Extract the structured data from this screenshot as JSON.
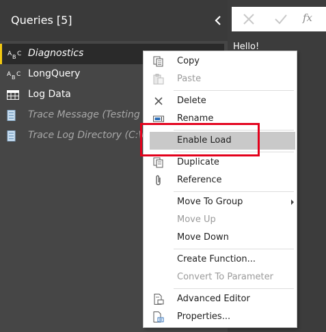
{
  "pane": {
    "title": "Queries [5]",
    "queries": [
      {
        "label": "Diagnostics",
        "icon": "text-type-icon",
        "selected": true
      },
      {
        "label": "LongQuery",
        "icon": "text-type-icon"
      },
      {
        "label": "Log Data",
        "icon": "table-icon"
      },
      {
        "label": "Trace Message (Testing Lon",
        "icon": "list-icon"
      },
      {
        "label": "Trace Log Directory (C:\\Us",
        "icon": "list-icon"
      }
    ]
  },
  "preview": {
    "text": "Hello!"
  },
  "formula_bar": {
    "fx_label": "fx"
  },
  "menu": {
    "items": [
      {
        "label": "Copy",
        "icon": "copy-icon",
        "enabled": true
      },
      {
        "label": "Paste",
        "icon": "paste-icon",
        "enabled": false
      },
      {
        "label": "Delete",
        "icon": "delete-icon",
        "enabled": true
      },
      {
        "label": "Rename",
        "icon": "rename-icon",
        "enabled": true
      },
      {
        "label": "Enable Load",
        "enabled": true,
        "highlighted": true
      },
      {
        "label": "Duplicate",
        "icon": "duplicate-icon",
        "enabled": true
      },
      {
        "label": "Reference",
        "icon": "paperclip-icon",
        "enabled": true
      },
      {
        "label": "Move To Group",
        "enabled": true,
        "submenu": true
      },
      {
        "label": "Move Up",
        "enabled": false
      },
      {
        "label": "Move Down",
        "enabled": true
      },
      {
        "label": "Create Function...",
        "enabled": true
      },
      {
        "label": "Convert To Parameter",
        "enabled": false
      },
      {
        "label": "Advanced Editor",
        "icon": "advanced-editor-icon",
        "enabled": true
      },
      {
        "label": "Properties...",
        "icon": "properties-icon",
        "enabled": true
      }
    ]
  },
  "colors": {
    "accent": "#f2c811",
    "highlight_box": "#e3001b"
  }
}
